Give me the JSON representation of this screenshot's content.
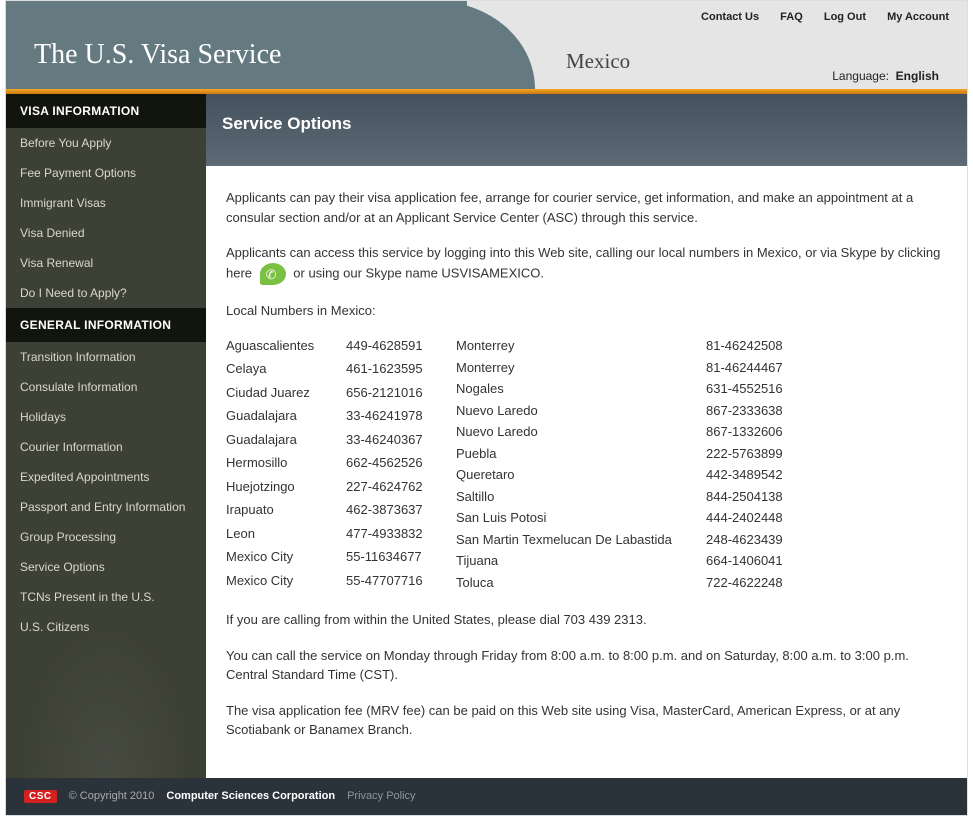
{
  "header": {
    "site_title": "The U.S. Visa Service",
    "country": "Mexico",
    "top_links": {
      "contact": "Contact Us",
      "faq": "FAQ",
      "logout": "Log Out",
      "account": "My Account"
    },
    "language_label": "Language:",
    "language_value": "English"
  },
  "sidebar": {
    "section1_title": "VISA INFORMATION",
    "section1": [
      "Before You Apply",
      "Fee Payment Options",
      "Immigrant Visas",
      "Visa Denied",
      "Visa Renewal",
      "Do I Need to Apply?"
    ],
    "section2_title": "GENERAL INFORMATION",
    "section2": [
      "Transition Information",
      "Consulate Information",
      "Holidays",
      "Courier Information",
      "Expedited Appointments",
      "Passport and Entry Information",
      "Group Processing",
      "Service Options",
      "TCNs Present in the U.S.",
      "U.S. Citizens"
    ]
  },
  "main": {
    "page_title": "Service Options",
    "intro1": "Applicants can pay their visa application fee, arrange for courier service, get information, and make an appointment at a consular section and/or at an Applicant Service Center (ASC) through this service.",
    "intro2a": "Applicants can access this service by logging into this Web site, calling our local numbers in Mexico, or via Skype by clicking here",
    "intro2b": "or using our Skype name USVISAMEXICO.",
    "local_label": "Local Numbers in Mexico:",
    "phones_left": [
      {
        "city": "Aguascalientes",
        "num": "449-4628591"
      },
      {
        "city": "Celaya",
        "num": "461-1623595"
      },
      {
        "city": "Ciudad Juarez",
        "num": "656-2121016"
      },
      {
        "city": "Guadalajara",
        "num": "33-46241978"
      },
      {
        "city": "Guadalajara",
        "num": "33-46240367"
      },
      {
        "city": "Hermosillo",
        "num": "662-4562526"
      },
      {
        "city": "Huejotzingo",
        "num": "227-4624762"
      },
      {
        "city": "Irapuato",
        "num": "462-3873637"
      },
      {
        "city": "Leon",
        "num": "477-4933832"
      },
      {
        "city": "Mexico City",
        "num": "55-11634677"
      },
      {
        "city": "Mexico City",
        "num": "55-47707716"
      }
    ],
    "phones_right": [
      {
        "city": "Monterrey",
        "num": "81-46242508"
      },
      {
        "city": "Monterrey",
        "num": "81-46244467"
      },
      {
        "city": "Nogales",
        "num": "631-4552516"
      },
      {
        "city": "Nuevo Laredo",
        "num": "867-2333638"
      },
      {
        "city": "Nuevo Laredo",
        "num": "867-1332606"
      },
      {
        "city": "Puebla",
        "num": "222-5763899"
      },
      {
        "city": "Queretaro",
        "num": "442-3489542"
      },
      {
        "city": "Saltillo",
        "num": "844-2504138"
      },
      {
        "city": "San Luis Potosi",
        "num": "444-2402448"
      },
      {
        "city": "San Martin Texmelucan De Labastida",
        "num": "248-4623439"
      },
      {
        "city": "Tijuana",
        "num": "664-1406041"
      },
      {
        "city": "Toluca",
        "num": "722-4622248"
      }
    ],
    "us_note": "If you are calling from within the United States, please dial 703 439 2313.",
    "hours_note": "You can call the service on Monday through Friday from 8:00 a.m. to 8:00 p.m. and on Saturday, 8:00 a.m. to 3:00 p.m. Central Standard Time (CST).",
    "fee_note": "The visa application fee (MRV fee) can be paid on this Web site using Visa, MasterCard, American Express, or at any Scotiabank or Banamex Branch."
  },
  "footer": {
    "logo": "CSC",
    "copyright": "© Copyright 2010",
    "corp": "Computer Sciences Corporation",
    "privacy": "Privacy Policy"
  }
}
